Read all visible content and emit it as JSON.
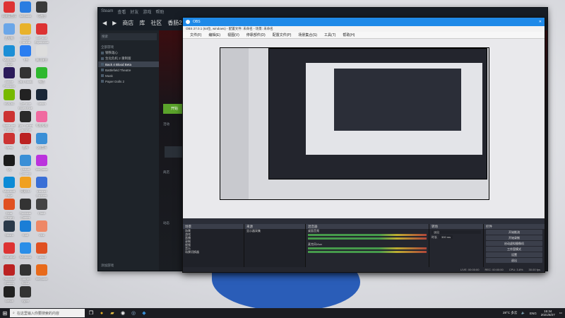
{
  "desktop": {
    "icons": [
      {
        "label": "网易云音乐",
        "color": "#d33"
      },
      {
        "label": "WeGame",
        "color": "#2a7de1"
      },
      {
        "label": "乐曲谷",
        "color": "#3a3a3a"
      },
      {
        "label": "此电脑",
        "color": "#6aa6e8"
      },
      {
        "label": "Google Chrome",
        "color": "#e8b22a"
      },
      {
        "label": "GeForce Experience",
        "color": "#d33"
      },
      {
        "label": "Microsoft Edge",
        "color": "#1c8fd6"
      },
      {
        "label": "飞书",
        "color": "#2b7ef0"
      },
      {
        "label": "腾讯课堂",
        "color": "#ddd"
      },
      {
        "label": "Adobe Premiere",
        "color": "#2b1b5a"
      },
      {
        "label": "OBS Studio",
        "color": "#333"
      },
      {
        "label": "微信",
        "color": "#2eb82e"
      },
      {
        "label": "NVIDIA",
        "color": "#76b900"
      },
      {
        "label": "GeForce Experience",
        "color": "#222"
      },
      {
        "label": "Steam",
        "color": "#1b2838"
      },
      {
        "label": "Battle.net Theatre",
        "color": "#c33"
      },
      {
        "label": "Epic Games Launcher",
        "color": "#2a2a2a"
      },
      {
        "label": "哔哩哔哩",
        "color": "#f06aa0"
      },
      {
        "label": "Uplay",
        "color": "#c33"
      },
      {
        "label": "雷神",
        "color": "#b22"
      },
      {
        "label": "QQ音乐",
        "color": "#3a8fd6"
      },
      {
        "label": "QQ",
        "color": "#1c1c1c"
      },
      {
        "label": "Ubisoft Connect",
        "color": "#3a8fd6"
      },
      {
        "label": "WeGame",
        "color": "#b3d"
      },
      {
        "label": "Microsoft Edge",
        "color": "#0c8bd6"
      },
      {
        "label": "网易UU",
        "color": "#f0a020"
      },
      {
        "label": "Internet Explorer",
        "color": "#3a6fd6"
      },
      {
        "label": "Dear Hungry",
        "color": "#e05020"
      },
      {
        "label": "Rockstar Games",
        "color": "#333"
      },
      {
        "label": "Clash",
        "color": "#444"
      },
      {
        "label": "Steam",
        "color": "#2b3a4a"
      },
      {
        "label": "Kodi",
        "color": "#1b7ed6"
      },
      {
        "label": "Vibe",
        "color": "#e86"
      },
      {
        "label": "OneDrive",
        "color": "#d33"
      },
      {
        "label": "Windows",
        "color": "#2a8ee8"
      },
      {
        "label": "Cursor",
        "color": "#e05020"
      },
      {
        "label": "Rockstar Games",
        "color": "#b22"
      },
      {
        "label": "Counter Strike",
        "color": "#333"
      },
      {
        "label": "WeGame",
        "color": "#e86a1a"
      },
      {
        "label": "Github",
        "color": "#222"
      },
      {
        "label": "Vyper",
        "color": "#333"
      }
    ]
  },
  "steam": {
    "nav": [
      "商店",
      "库",
      "社区",
      "香肠233"
    ],
    "top": [
      "Steam",
      "查看",
      "好友",
      "游戏",
      "帮助"
    ],
    "search_label": "搜索",
    "sidebar_header": "全部游戏",
    "games": [
      "钢铁雄心",
      "生化危机 2 重制版",
      "Back 4 Blood Beta",
      "Battlefield Theatre",
      "Musk",
      "Paper Dolls 2"
    ],
    "selected_game": "Back 4 Blood Beta",
    "play_label": "开始",
    "add_game": "添加游戏",
    "section_labels": [
      "活动",
      "商店",
      "动态"
    ]
  },
  "obs": {
    "title": "OBS",
    "subtitle": "OBS 27.0.1 (64位, windows) - 配置文件: 未命名 - 场景: 未命名",
    "menu": [
      "文件(F)",
      "编辑(E)",
      "视图(V)",
      "停靠部件(D)",
      "配置文件(P)",
      "场景集合(S)",
      "工具(T)",
      "帮助(H)"
    ],
    "docks": {
      "scenes": {
        "title": "场景",
        "items": [
          "场景",
          "游戏",
          "直播",
          "录制",
          "视频",
          "音乐",
          "场景切换器"
        ]
      },
      "sources": {
        "title": "来源",
        "items": [
          "显示器采集"
        ]
      },
      "mixer": {
        "title": "混音器",
        "channels": [
          "桌面音频",
          "麦克风/Aux"
        ]
      },
      "transitions": {
        "title": "转场",
        "type": "淡出",
        "duration_label": "时长",
        "duration": "300 ms"
      },
      "controls": {
        "title": "控件",
        "buttons": [
          "开始推流",
          "开始录制",
          "启动虚拟摄像机",
          "工作室模式",
          "设置",
          "退出"
        ]
      }
    },
    "status": [
      "LIVE: 00:00:00",
      "REC: 00:00:00",
      "CPU: 3.8%",
      "30.00 fps"
    ]
  },
  "taskbar": {
    "search_placeholder": "在这里输入你要搜索的内容",
    "weather": "28°C 多云",
    "lang": "ENG",
    "time": "15:34",
    "date": "2021/8/27"
  }
}
